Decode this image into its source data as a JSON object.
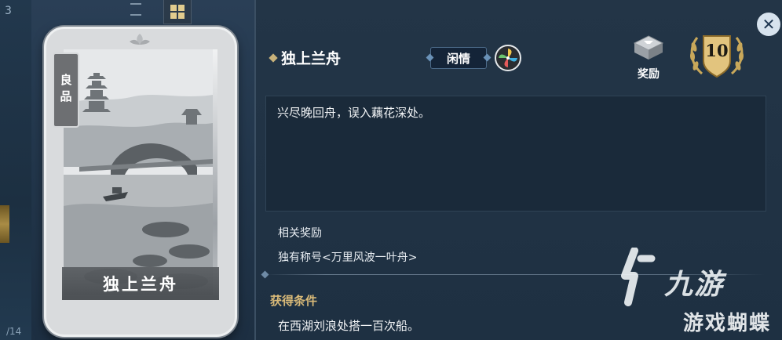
{
  "background": {
    "left_number": "3",
    "bottom_number": "/14"
  },
  "card": {
    "quality": "良品",
    "name": "独上兰舟"
  },
  "detail": {
    "title": "独上兰舟",
    "category_tag": "闲情",
    "reward_label": "奖励",
    "level": "10",
    "close_icon": "close-icon",
    "description": "兴尽晚回舟，误入藕花深处。",
    "related_rewards_title": "相关奖励",
    "related_reward_item": "独有称号<万里风波一叶舟>",
    "condition_title": "获得条件",
    "condition_text": "在西湖刘浪处搭一百次船。"
  },
  "watermark": {
    "brand": "九游",
    "sub": "游戏蝴蝶"
  },
  "colors": {
    "panel_bg": "#1e3042",
    "accent_gold": "#d8b978",
    "tag_border": "#4d6b8a"
  }
}
